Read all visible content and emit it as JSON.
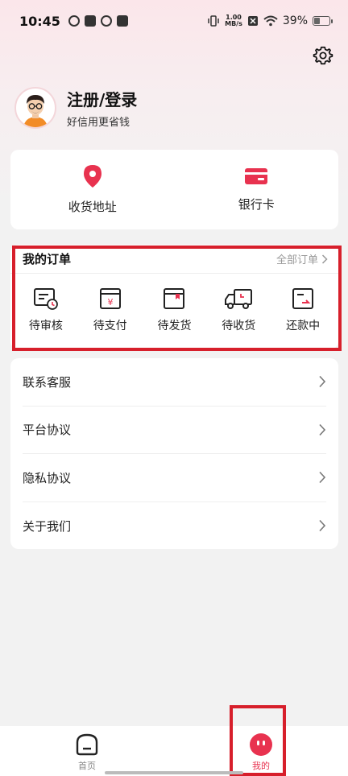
{
  "status_bar": {
    "time": "10:45",
    "net_speed_value": "1.00",
    "net_speed_unit": "MB/s",
    "battery": "39%"
  },
  "profile": {
    "title": "注册/登录",
    "subtitle": "好信用更省钱"
  },
  "quick_links": [
    {
      "label": "收货地址",
      "icon": "location-pin-icon"
    },
    {
      "label": "银行卡",
      "icon": "bank-card-icon"
    }
  ],
  "orders": {
    "title": "我的订单",
    "all_label": "全部订单",
    "items": [
      {
        "label": "待审核",
        "icon": "review-clock-icon"
      },
      {
        "label": "待支付",
        "icon": "yuan-wallet-icon"
      },
      {
        "label": "待发货",
        "icon": "package-box-icon"
      },
      {
        "label": "待收货",
        "icon": "delivery-truck-icon"
      },
      {
        "label": "还款中",
        "icon": "repayment-icon"
      }
    ]
  },
  "menu": [
    {
      "label": "联系客服"
    },
    {
      "label": "平台协议"
    },
    {
      "label": "隐私协议"
    },
    {
      "label": "关于我们"
    }
  ],
  "bottom_nav": [
    {
      "label": "首页",
      "icon": "home-icon",
      "active": false
    },
    {
      "label": "我的",
      "icon": "profile-face-icon",
      "active": true
    }
  ],
  "colors": {
    "accent": "#e8324f",
    "highlight_border": "#d71f2b"
  }
}
